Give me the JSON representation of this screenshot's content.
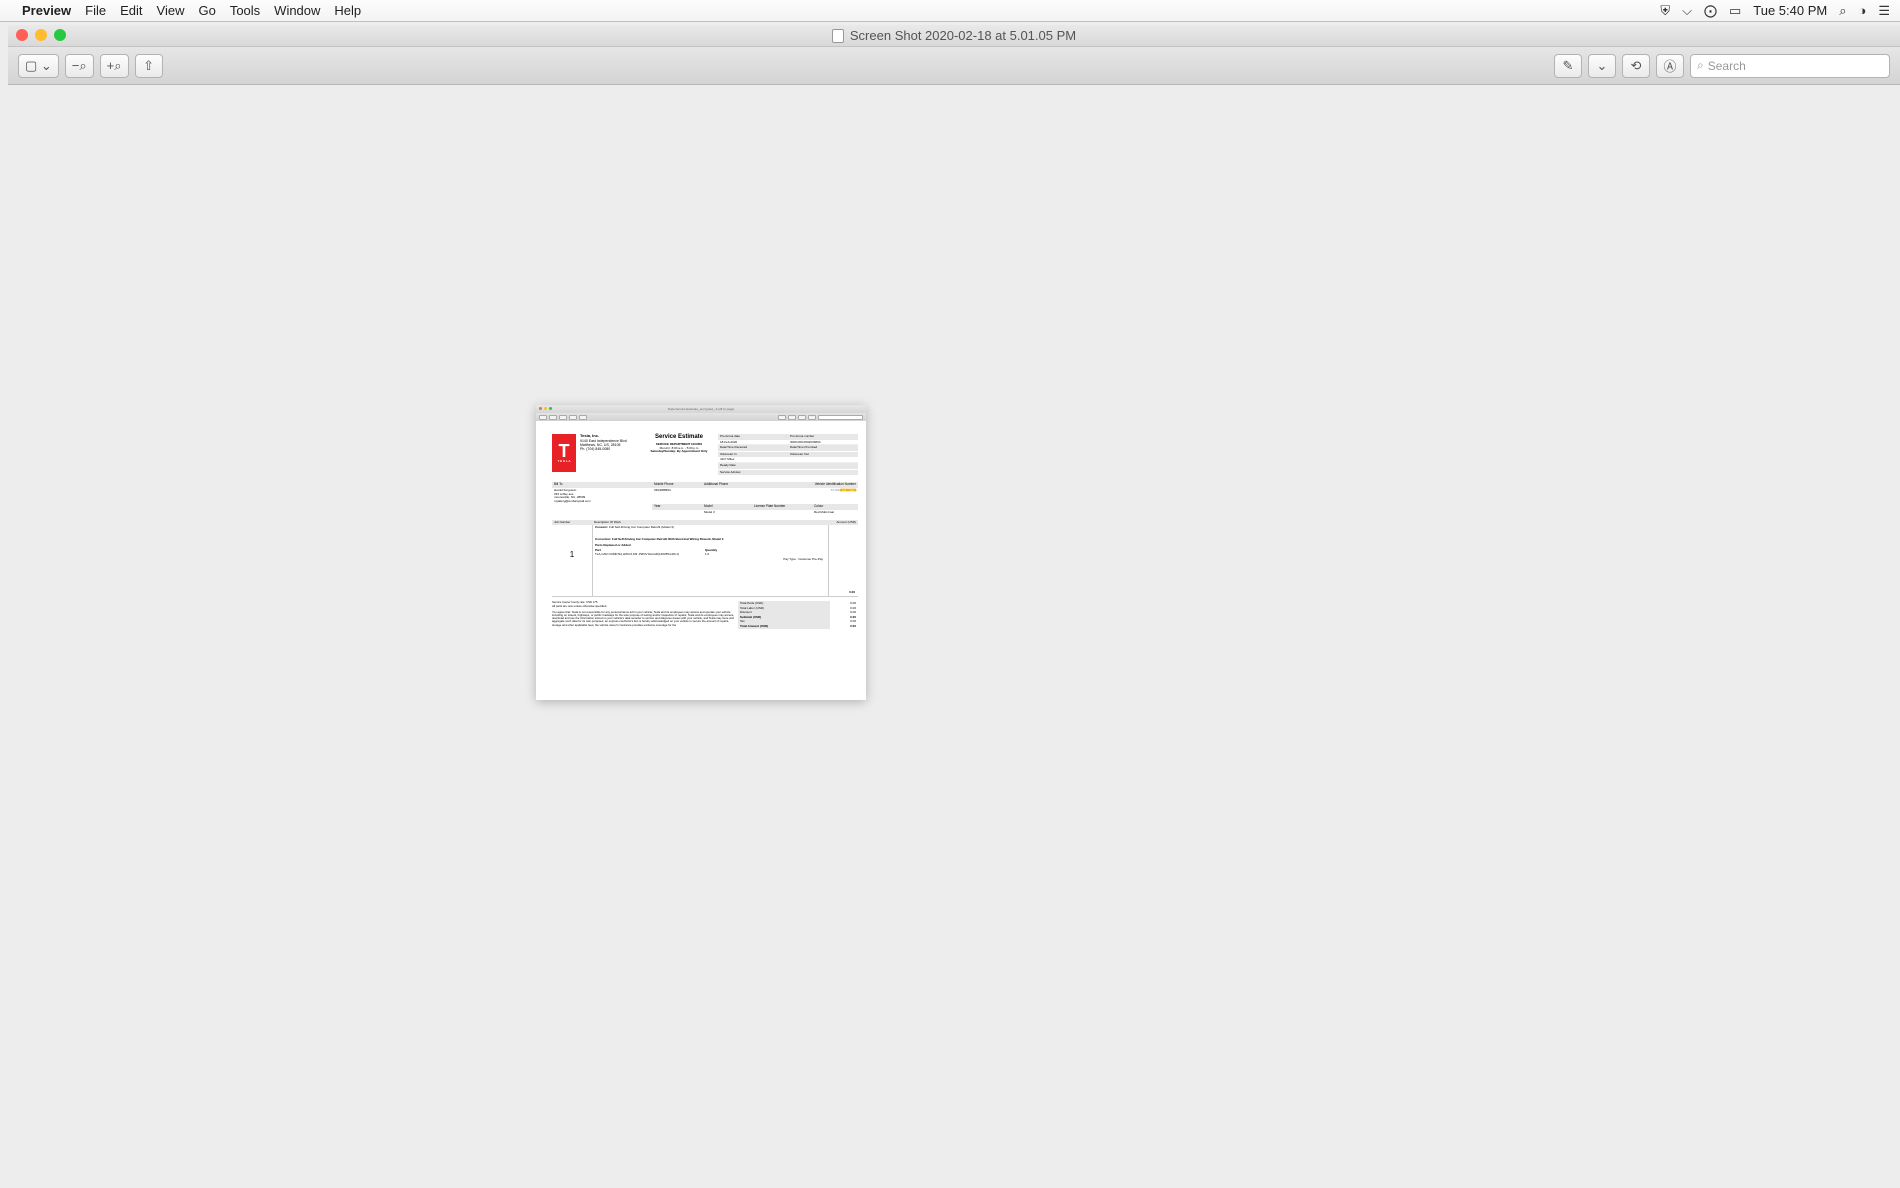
{
  "menubar": {
    "app": "Preview",
    "items": [
      "File",
      "Edit",
      "View",
      "Go",
      "Tools",
      "Window",
      "Help"
    ],
    "clock": "Tue 5:40 PM"
  },
  "window": {
    "title": "Screen Shot 2020-02-18 at 5.01.05 PM",
    "search_placeholder": "Search"
  },
  "thumb": {
    "title": "Tesla Service Estimate_encrypted_-2.pdf (1 page)"
  },
  "doc": {
    "company": "Tesla, Inc.",
    "addr1": "9140 East Independence Blvd",
    "addr2": "Matthews, NC, US, 28105",
    "phone": "Ph. (704) 845-0080",
    "estimate_title": "Service Estimate",
    "hours_header": "SERVICE DEPARTMENT HOURS",
    "hours1": "Mon-Fri: 8:00 a.m. - 5:00 p.m",
    "hours2": "Saturday/Sunday: By Appointment Only",
    "proforma": {
      "date_label": "Pro-forma date",
      "date_val": "18-Feb-2020",
      "number_label": "Pro-forma number",
      "number_val": "3000-009-0002036830",
      "received_label": "Date/Time Received",
      "promised_label": "Date/Time Promised",
      "odoin_label": "Odometer In",
      "odoin_val": "4117 Miles",
      "odoout_label": "Odometer Out",
      "ready_label": "Ready Date",
      "advisor_label": "Service Advisor"
    },
    "bill": {
      "billto_label": "Bill To",
      "mobile_label": "Mobile Phone",
      "additional_label": "Additional Phone",
      "vin_label": "Vehicle Identification Number",
      "name": "Harold Ferguson",
      "addr1": "333 coffey ave",
      "addr2": "mooresville, NC, 28609",
      "email": "mylaferg@embarqmail.com",
      "mobile": "3304088954",
      "vin": "5YJ3E",
      "year_label": "Year",
      "model_label": "Model",
      "plate_label": "License Plate Number",
      "colour_label": "Colour",
      "model_val": "Model 3",
      "colour_val": "Red Multi-Coat"
    },
    "job": {
      "jobnum_label": "Job Number",
      "descwork_label": "Description Of Work",
      "amount_label": "Amount (USD)",
      "concern_label": "Concern:",
      "concern_text": "Full Self-Driving Car Computer Retrofit (Model 3)",
      "correction_label": "Correction:",
      "correction_text": "Full Self-Driving Car Computer Retrofit With Electrical Wiring Rework, Model 3",
      "parts_label": "Parts Replaced or Added",
      "part_label": "Part",
      "qty_label": "Quantity",
      "jobnum": "1",
      "part_val": "TLA,CAR COMP,NA,HW3.0,M3 -PROV Retrofit(1462554-R0-J)",
      "qty_val": "1.0",
      "paytype_label": "Pay Type : Customer Pre-Pay",
      "paytype_amount": "0.00"
    },
    "footer": {
      "rate": "Service Center hourly rate: USD 175",
      "note": "All parts are new unless otherwise specified.",
      "disclaimer": "You agree that: Tesla is not responsible for any personal items left in your vehicle; Tesla and its employees may access and operate your vehicle including on streets, highways, or public roadways for the sole purpose of testing and/or inspection of repairs; Tesla and its employees may access, download and use the information stored on your vehicle's data recorder to service and diagnose issues with your vehicle, and Tesla may store and aggregate such data for its own purposes; an express mechanic's lien is hereby acknowledged on your vehicle to secure the amount of repairs, storage and other applicable fees; the vehicle owner's insurance provides exclusive coverage for the"
    },
    "totals": {
      "parts_lbl": "Total Parts (USD)",
      "parts_val": "0.00",
      "labor_lbl": "Total Labor (USD)",
      "labor_val": "0.00",
      "discount_lbl": "Discount",
      "discount_val": "0.00",
      "subtotal_lbl": "Subtotal (USD)",
      "subtotal_val": "0.00",
      "tax_lbl": "Tax",
      "tax_val": "0.00",
      "total_lbl": "Total Amount (USD)",
      "total_val": "0.00"
    }
  }
}
